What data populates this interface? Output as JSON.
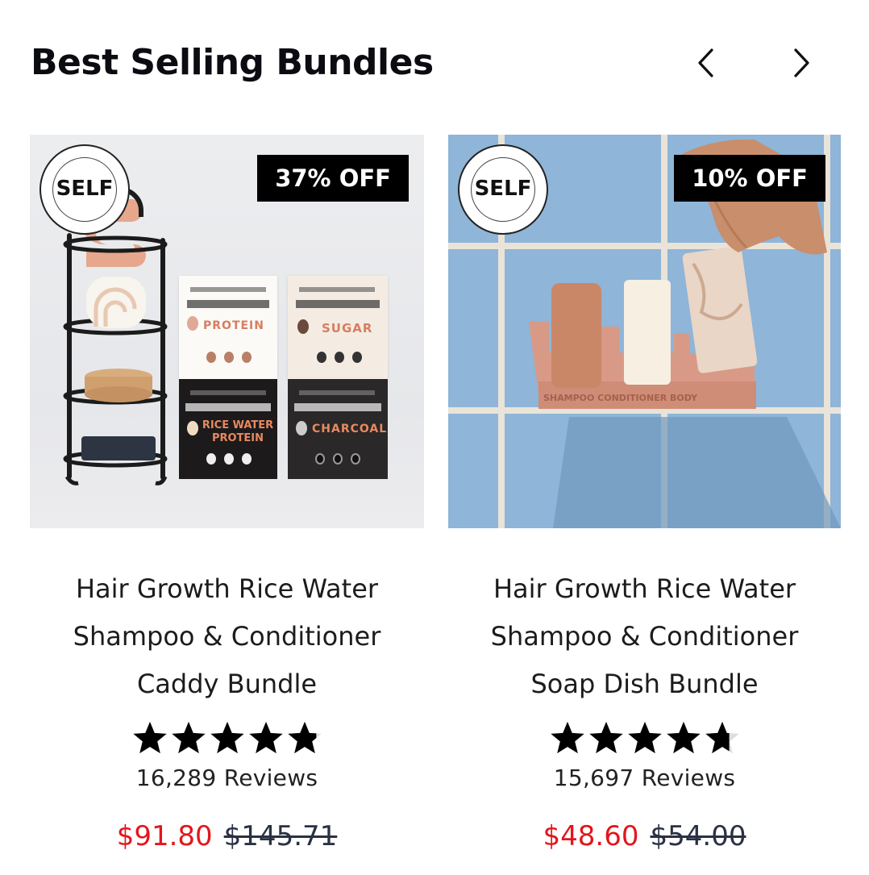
{
  "header": {
    "title": "Best Selling Bundles",
    "prev_icon": "chevron-left-icon",
    "next_icon": "chevron-right-icon"
  },
  "products": [
    {
      "badge": "37% OFF",
      "seal_text": "SELF",
      "name": "Hair Growth Rice Water Shampoo & Conditioner Caddy Bundle",
      "rating": 4.8,
      "reviews": "16,289 Reviews",
      "sale_price": "$91.80",
      "original_price": "$145.71",
      "packages": [
        "PROTEIN",
        "SUGAR",
        "RICE WATER PROTEIN",
        "CHARCOAL"
      ]
    },
    {
      "badge": "10% OFF",
      "seal_text": "SELF",
      "name": "Hair Growth Rice Water Shampoo & Conditioner Soap Dish Bundle",
      "rating": 4.7,
      "reviews": "15,697 Reviews",
      "sale_price": "$48.60",
      "original_price": "$54.00"
    }
  ],
  "colors": {
    "sale": "#e3161c",
    "original": "#2a3144",
    "badge_bg": "#000000",
    "tile_blue": "#8db3d6",
    "dish": "#d99985"
  }
}
